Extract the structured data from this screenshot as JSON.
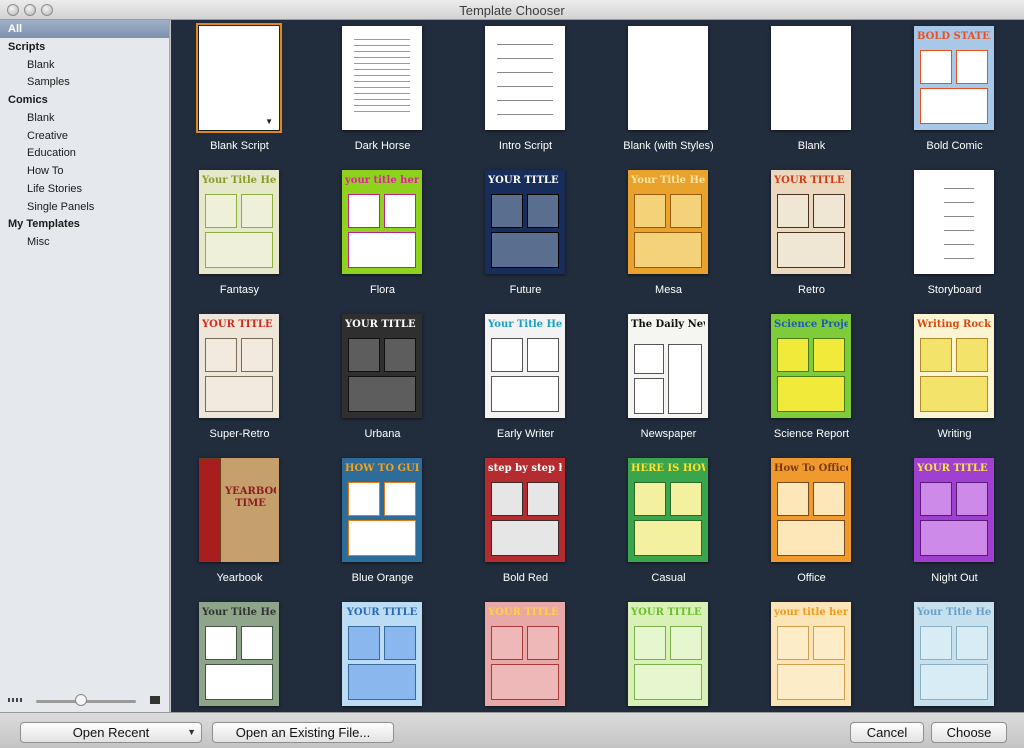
{
  "window": {
    "title": "Template Chooser"
  },
  "sidebar": {
    "items": [
      {
        "label": "All",
        "kind": "selected"
      },
      {
        "label": "Scripts",
        "kind": "head"
      },
      {
        "label": "Blank",
        "kind": "sub"
      },
      {
        "label": "Samples",
        "kind": "sub"
      },
      {
        "label": "Comics",
        "kind": "head"
      },
      {
        "label": "Blank",
        "kind": "sub"
      },
      {
        "label": "Creative",
        "kind": "sub"
      },
      {
        "label": "Education",
        "kind": "sub"
      },
      {
        "label": "How To",
        "kind": "sub"
      },
      {
        "label": "Life Stories",
        "kind": "sub"
      },
      {
        "label": "Single Panels",
        "kind": "sub"
      },
      {
        "label": "My Templates",
        "kind": "head"
      },
      {
        "label": "Misc",
        "kind": "sub"
      }
    ],
    "zoom_level": 0.45
  },
  "templates": [
    {
      "name": "Blank Script",
      "style": "blank",
      "selected": true
    },
    {
      "name": "Dark Horse",
      "style": "doc"
    },
    {
      "name": "Intro Script",
      "style": "doc2"
    },
    {
      "name": "Blank (with Styles)",
      "style": "plain"
    },
    {
      "name": "Blank",
      "style": "plain"
    },
    {
      "name": "Bold Comic",
      "style": "comic",
      "bg": "#a8c8ea",
      "title": "BOLD STATEMENTS",
      "title_color": "#e8501c",
      "panel": "#ffffff",
      "border": "#e8501c"
    },
    {
      "name": "Fantasy",
      "style": "comic",
      "bg": "#e6e9c9",
      "title": "Your Title Here",
      "title_color": "#8a9a2a",
      "panel": "#eef0da",
      "border": "#8ab040"
    },
    {
      "name": "Flora",
      "style": "comic",
      "bg": "#8fd21e",
      "title": "your title here",
      "title_color": "#e020a0",
      "panel": "#ffffff",
      "border": "#c0208a"
    },
    {
      "name": "Future",
      "style": "comic",
      "bg": "#172e5a",
      "title": "YOUR TITLE HERE",
      "title_color": "#ffffff",
      "panel": "#5a6f8f",
      "border": "#000000"
    },
    {
      "name": "Mesa",
      "style": "comic",
      "bg": "#e9a22c",
      "title": "Your Title Here",
      "title_color": "#ffe6a0",
      "panel": "#f3d27a",
      "border": "#9a5a10"
    },
    {
      "name": "Retro",
      "style": "comic",
      "bg": "#ead9bf",
      "title": "YOUR TITLE HERE",
      "title_color": "#d33c14",
      "panel": "#efe6d4",
      "border": "#4a3020"
    },
    {
      "name": "Storyboard",
      "style": "doc3"
    },
    {
      "name": "Super-Retro",
      "style": "comic",
      "bg": "#efe6da",
      "title": "YOUR TITLE HERE",
      "title_color": "#d22a1c",
      "panel": "#f2eadf",
      "border": "#7a6a5a"
    },
    {
      "name": "Urbana",
      "style": "comic",
      "bg": "#2f2f2f",
      "title": "YOUR TITLE HERE",
      "title_color": "#ffffff",
      "panel": "#5d5d5d",
      "border": "#111111"
    },
    {
      "name": "Early Writer",
      "style": "comic",
      "bg": "#f3f3f3",
      "title": "Your Title Here",
      "title_color": "#1aa0c8",
      "panel": "#ffffff",
      "border": "#555555"
    },
    {
      "name": "Newspaper",
      "style": "news",
      "bg": "#f5f5f2",
      "title": "The Daily News",
      "title_color": "#111111",
      "panel": "#ffffff",
      "border": "#555555"
    },
    {
      "name": "Science Report",
      "style": "comic",
      "bg": "#7fcc3a",
      "title": "Science Project",
      "title_color": "#1e5ab4",
      "panel": "#f2ea3a",
      "border": "#4a7a1a"
    },
    {
      "name": "Writing",
      "style": "comic",
      "bg": "#fbf5d3",
      "title": "Writing Rocks!",
      "title_color": "#d64a10",
      "panel": "#f3e36a",
      "border": "#b08a2a"
    },
    {
      "name": "Yearbook",
      "style": "yearbook",
      "bg": "#c5a06c",
      "title": "YEARBOOK TIME",
      "title_color": "#8a1e1e",
      "panel": "#a81e1e",
      "border": "#6a4020"
    },
    {
      "name": "Blue Orange",
      "style": "comic",
      "bg": "#2e6c9a",
      "title": "HOW TO GUIDE",
      "title_color": "#f2a21c",
      "panel": "#ffffff",
      "border": "#e07a18"
    },
    {
      "name": "Bold Red",
      "style": "comic",
      "bg": "#b42c30",
      "title": "step by step how to",
      "title_color": "#ffffff",
      "panel": "#e6e6e6",
      "border": "#3a2a2a"
    },
    {
      "name": "Casual",
      "style": "comic",
      "bg": "#3aa54a",
      "title": "HERE IS HOW TO",
      "title_color": "#ffe030",
      "panel": "#f3f0a0",
      "border": "#2a6a2a"
    },
    {
      "name": "Office",
      "style": "comic",
      "bg": "#f09a2e",
      "title": "How To Office Guide",
      "title_color": "#7a3a10",
      "panel": "#fde6b8",
      "border": "#7a4a20"
    },
    {
      "name": "Night Out",
      "style": "comic",
      "bg": "#a040d0",
      "title": "YOUR TITLE HERE",
      "title_color": "#ffe24a",
      "panel": "#cd8ae8",
      "border": "#5a1a7a"
    },
    {
      "name": "",
      "style": "comic",
      "bg": "#8fa58a",
      "title": "Your Title Here",
      "title_color": "#333333",
      "panel": "#ffffff",
      "border": "#445544"
    },
    {
      "name": "",
      "style": "comic",
      "bg": "#bcdcf6",
      "title": "YOUR TITLE",
      "title_color": "#2a6ab4",
      "panel": "#8ab8ee",
      "border": "#3a6a9a"
    },
    {
      "name": "",
      "style": "comic",
      "bg": "#e9a8a8",
      "title": "YOUR TITLE HERE",
      "title_color": "#ffd040",
      "panel": "#efb8b8",
      "border": "#aa3a3a"
    },
    {
      "name": "",
      "style": "comic",
      "bg": "#d9f0b6",
      "title": "YOUR TITLE HERE",
      "title_color": "#6ac030",
      "panel": "#e6f6cf",
      "border": "#7ab04a"
    },
    {
      "name": "",
      "style": "comic",
      "bg": "#fbe4b6",
      "title": "your title here",
      "title_color": "#f09a1c",
      "panel": "#fcecc8",
      "border": "#d0a050"
    },
    {
      "name": "",
      "style": "comic",
      "bg": "#c6e0ee",
      "title": "Your Title Here",
      "title_color": "#6aa0c8",
      "panel": "#d8ecf6",
      "border": "#8ab0c8"
    }
  ],
  "footer": {
    "open_recent": "Open Recent",
    "open_existing": "Open an Existing File...",
    "cancel": "Cancel",
    "choose": "Choose"
  }
}
